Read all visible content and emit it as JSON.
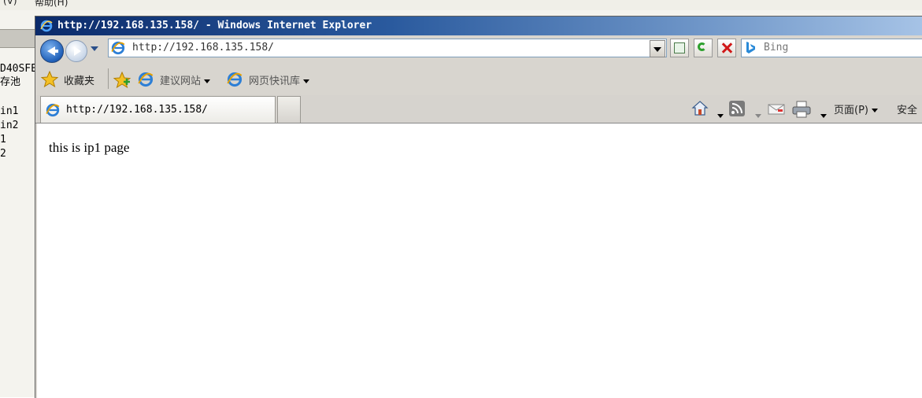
{
  "background_window": {
    "menu_items": [
      "(V)",
      "帮助(H)"
    ],
    "side_lines": [
      "D40SFE",
      "存池",
      "in1",
      "in2",
      "1",
      "2"
    ]
  },
  "window": {
    "title": "http://192.168.135.158/ - Windows Internet Explorer"
  },
  "address_bar": {
    "url": "http://192.168.135.158/"
  },
  "search": {
    "placeholder": "Bing"
  },
  "favorites_bar": {
    "favorites_label": "收藏夹",
    "suggested_sites_label": "建议网站",
    "web_slice_gallery_label": "网页快讯库"
  },
  "tabs": [
    {
      "label": "http://192.168.135.158/"
    }
  ],
  "command_bar": {
    "page_label": "页面(P)",
    "safety_label": "安全"
  },
  "page": {
    "body_text": "this is ip1 page"
  },
  "colors": {
    "titlebar_start": "#0b2a6a",
    "titlebar_end": "#a6c3e6",
    "chrome": "#d6d3ce"
  }
}
